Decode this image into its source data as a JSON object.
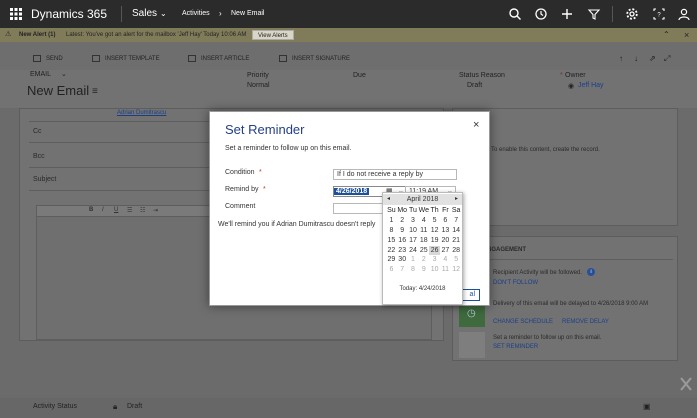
{
  "nav": {
    "app_name": "Dynamics 365",
    "area": "Sales",
    "breadcrumb_1": "Activities",
    "breadcrumb_sep": "›",
    "breadcrumb_2": "New Email"
  },
  "alert": {
    "title": "New Alert (1)",
    "message": "Latest: You've got an alert for the mailbox 'Jeff Hay' Today 10:06 AM",
    "button": "View Alerts"
  },
  "commands": [
    "SEND",
    "INSERT TEMPLATE",
    "INSERT ARTICLE",
    "INSERT SIGNATURE"
  ],
  "header": {
    "entity_type": "EMAIL",
    "title": "New Email",
    "priority_label": "Priority",
    "priority_value": "Normal",
    "due_label": "Due",
    "status_reason_label": "Status Reason",
    "status_reason_value": "Draft",
    "owner_label": "Owner",
    "owner_value": "Jeff Hay"
  },
  "form": {
    "to_value": "Adrian Dumitrascu",
    "cc_label": "Cc",
    "bcc_label": "Bcc",
    "subject_label": "Subject",
    "right_panel_hint": "To enable this content, create the record."
  },
  "engagement": {
    "title": "ENGAGEMENT",
    "item1_text": "Recipient Activity will be followed.",
    "item1_link": "DON'T FOLLOW",
    "item2_text": "Delivery of this email will be delayed to 4/26/2018 9:00 AM",
    "item2_link1": "CHANGE SCHEDULE",
    "item2_link2": "REMOVE DELAY",
    "item3_text": "Set a reminder to follow up on this email.",
    "item3_link": "SET REMINDER"
  },
  "status": {
    "label": "Activity Status",
    "value": "Draft"
  },
  "modal": {
    "title": "Set Reminder",
    "close": "×",
    "description": "Set a reminder to follow up on this email.",
    "condition_label": "Condition",
    "condition_value": "If I do not receive a reply by",
    "remind_label": "Remind by",
    "required_mark": "*",
    "date_value": "4/26/2018",
    "time_value": "11:19 AM",
    "comment_label": "Comment",
    "comment_value": "",
    "note_text": "We'll remind you if Adrian Dumitrascu doesn't reply",
    "button_partial": "al"
  },
  "calendar": {
    "month_label": "April 2018",
    "prev": "◂",
    "next": "▸",
    "weekdays": [
      "Su",
      "Mo",
      "Tu",
      "We",
      "Th",
      "Fr",
      "Sa"
    ],
    "weeks": [
      [
        "1",
        "2",
        "3",
        "4",
        "5",
        "6",
        "7"
      ],
      [
        "8",
        "9",
        "10",
        "11",
        "12",
        "13",
        "14"
      ],
      [
        "15",
        "16",
        "17",
        "18",
        "19",
        "20",
        "21"
      ],
      [
        "22",
        "23",
        "24",
        "25",
        "26",
        "27",
        "28"
      ],
      [
        "29",
        "30",
        "1",
        "2",
        "3",
        "4",
        "5"
      ],
      [
        "6",
        "7",
        "8",
        "9",
        "10",
        "11",
        "12"
      ]
    ],
    "selected": "26",
    "today_label": "Today: 4/24/2018"
  },
  "colors": {
    "nav_bg": "#2b2b2b",
    "alert_bg": "#807c5a",
    "link_blue": "#1a3f8a",
    "required_red": "#c0392b",
    "date_highlight": "#1e4f9a"
  }
}
